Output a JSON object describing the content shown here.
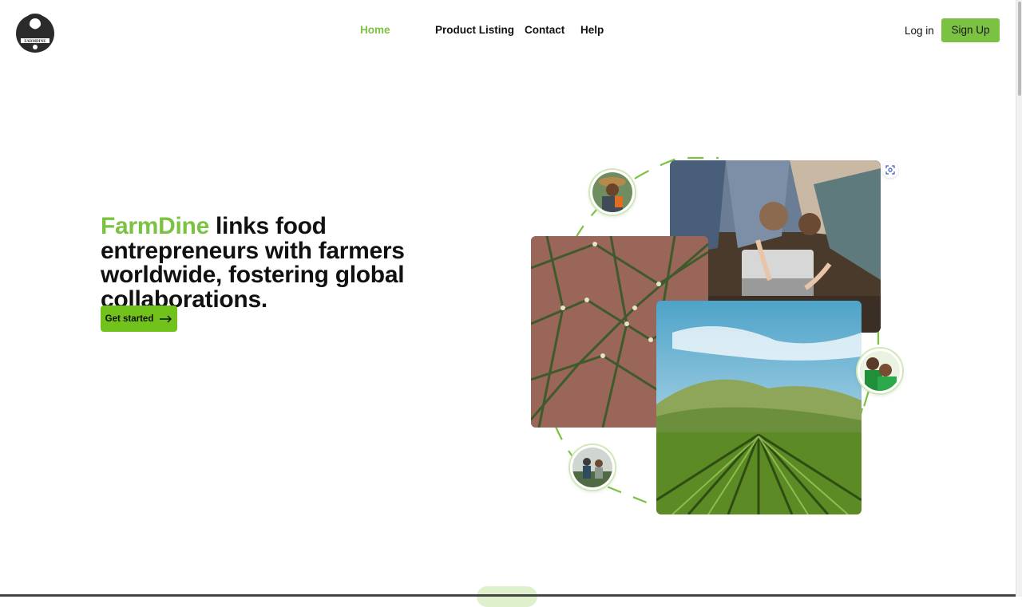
{
  "header": {
    "logo_icon": "farmdine-farmer-logo",
    "nav": [
      {
        "label": "Home",
        "active": true
      },
      {
        "label": "Product Listing",
        "active": false
      },
      {
        "label": "Contact",
        "active": false
      },
      {
        "label": "Help",
        "active": false
      }
    ],
    "login_label": "Log in",
    "signup_label": "Sign Up"
  },
  "hero": {
    "brand": "FarmDine",
    "headline_rest": " links food entrepreneurs with farmers worldwide, fostering global collaborations.",
    "cta_label": "Get started",
    "cta_icon": "arrow-right-icon"
  },
  "collage": {
    "photos": [
      "laptop-team-photo",
      "network-structure-photo",
      "vineyard-field-photo"
    ],
    "avatars": [
      "farmer-with-carrots-avatar",
      "smiling-couple-avatar",
      "greenhouse-workers-avatar"
    ],
    "focus_icon": "focus-scan-icon"
  },
  "colors": {
    "accent": "#7cc242",
    "cta": "#72c21c",
    "text": "#111111"
  }
}
